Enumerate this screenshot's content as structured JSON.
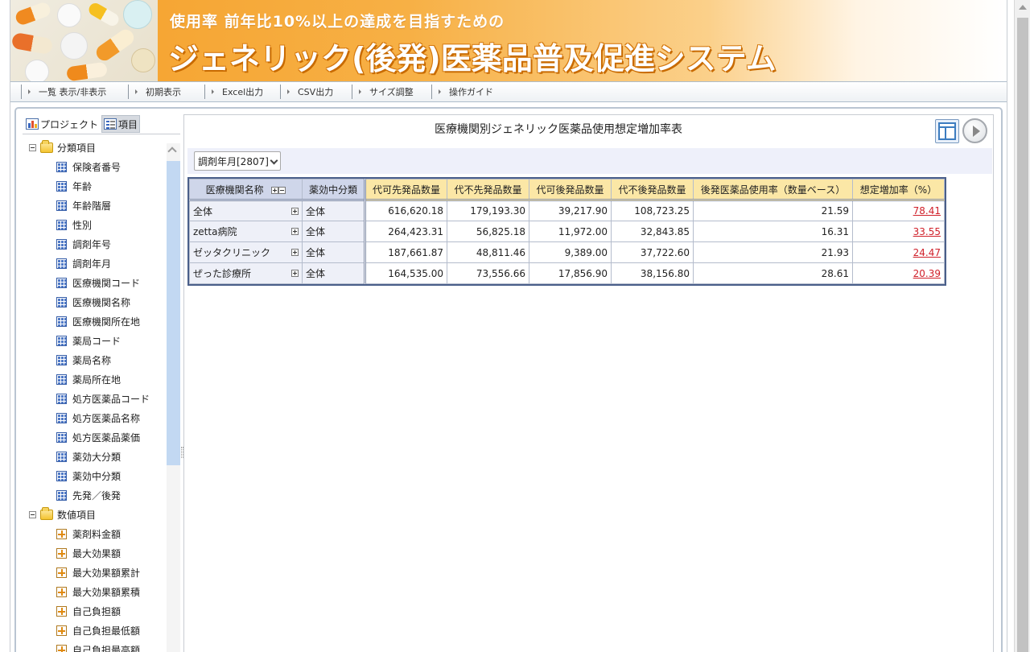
{
  "banner": {
    "subtitle": "使用率 前年比10%以上の達成を目指すための",
    "title": "ジェネリック(後発)医薬品普及促進システム"
  },
  "toolbar": {
    "items": [
      "一覧 表示/非表示",
      "初期表示",
      "Excel出力",
      "CSV出力",
      "サイズ調整",
      "操作ガイド"
    ]
  },
  "left_panel": {
    "tabs": [
      "プロジェクト",
      "項目"
    ],
    "groups": [
      {
        "label": "分類項目",
        "items": [
          "保険者番号",
          "年齢",
          "年齢階層",
          "性別",
          "調剤年号",
          "調剤年月",
          "医療機関コード",
          "医療機関名称",
          "医療機関所在地",
          "薬局コード",
          "薬局名称",
          "薬局所在地",
          "処方医薬品コード",
          "処方医薬品名称",
          "処方医薬品薬価",
          "薬効大分類",
          "薬効中分類",
          "先発／後発"
        ]
      },
      {
        "label": "数値項目",
        "items": [
          "薬剤料金額",
          "最大効果額",
          "最大効果額累計",
          "最大効果額累積",
          "自己負担額",
          "自己負担最低額",
          "自己負担最高額"
        ]
      }
    ]
  },
  "report": {
    "title": "医療機関別ジェネリック医薬品使用想定増加率表",
    "filter": {
      "selected": "調剤年月[2807]"
    },
    "headers": [
      "医療機関名称",
      "薬効中分類",
      "代可先発品数量",
      "代不先発品数量",
      "代可後発品数量",
      "代不後発品数量",
      "後発医薬品使用率（数量ベース）",
      "想定増加率（%）"
    ],
    "rows": [
      {
        "name": "全体",
        "category": "全体",
        "values": [
          "616,620.18",
          "179,193.30",
          "39,217.90",
          "108,723.25",
          "21.59"
        ],
        "rate": "78.41"
      },
      {
        "name": "zetta病院",
        "category": "全体",
        "values": [
          "264,423.31",
          "56,825.18",
          "11,972.00",
          "32,843.85",
          "16.31"
        ],
        "rate": "33.55"
      },
      {
        "name": "ゼッタクリニック",
        "category": "全体",
        "values": [
          "187,661.87",
          "48,811.46",
          "9,389.00",
          "37,722.60",
          "21.93"
        ],
        "rate": "24.47"
      },
      {
        "name": "ぜった診療所",
        "category": "全体",
        "values": [
          "164,535.00",
          "73,556.66",
          "17,856.90",
          "38,156.80",
          "28.61"
        ],
        "rate": "20.39"
      }
    ]
  }
}
